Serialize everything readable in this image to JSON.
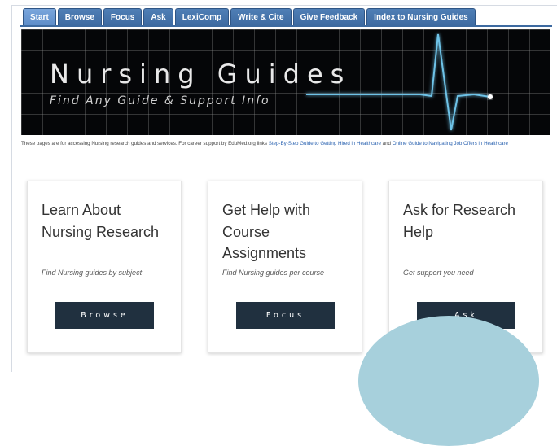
{
  "tabs": [
    {
      "label": "Start",
      "active": true
    },
    {
      "label": "Browse"
    },
    {
      "label": "Focus"
    },
    {
      "label": "Ask"
    },
    {
      "label": "LexiComp"
    },
    {
      "label": "Write & Cite"
    },
    {
      "label": "Give Feedback"
    },
    {
      "label": "Index to Nursing Guides"
    }
  ],
  "banner": {
    "title": "Nursing Guides",
    "subtitle": "Find Any Guide & Support Info"
  },
  "intro": {
    "text": "These pages are for accessing Nursing research guides and services. For career support by EduMed.org links ",
    "link1": "Step-By-Step Guide to Getting Hired in Healthcare",
    "and": " and ",
    "link2": "Online Guide to Navigating Job Offers in Healthcare"
  },
  "cards": [
    {
      "title": "Learn About Nursing Research",
      "desc": "Find Nursing guides by subject",
      "button": "Browse"
    },
    {
      "title": "Get Help with Course Assignments",
      "desc": "Find Nursing guides per course",
      "button": "Focus"
    },
    {
      "title": "Ask for Research Help",
      "desc": "Get support you need",
      "button": "Ask"
    }
  ],
  "colors": {
    "tab_bg": "#3d6aa0",
    "tab_active": "#6f9bd4",
    "button_bg": "#20303f",
    "banner_line": "#6ec3e8",
    "circle": "#a7d0dc"
  }
}
